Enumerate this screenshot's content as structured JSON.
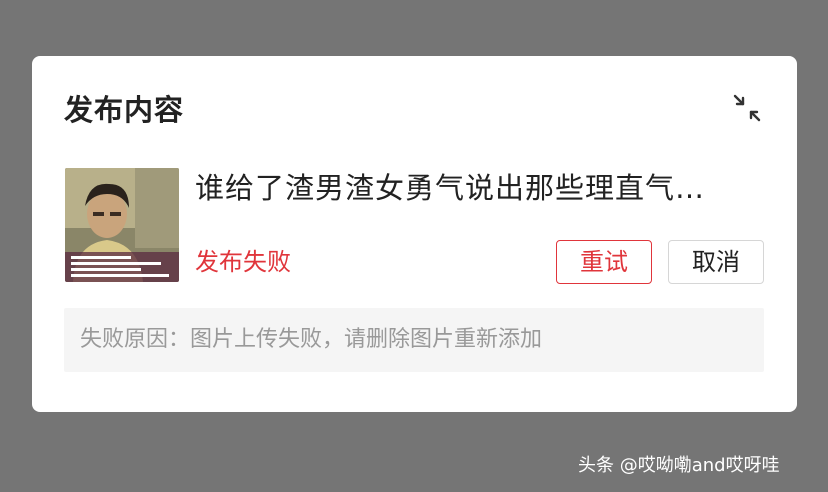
{
  "dialog": {
    "title": "发布内容",
    "collapse_icon": "collapse-arrows-icon"
  },
  "post": {
    "thumbnail_icon": "video-thumbnail",
    "title": "谁给了渣男渣女勇气说出那些理直气…",
    "status": "发布失败"
  },
  "actions": {
    "retry_label": "重试",
    "cancel_label": "取消"
  },
  "reason": {
    "text": "失败原因：图片上传失败，请删除图片重新添加"
  },
  "watermark": {
    "text": "头条 @哎呦嘞and哎呀哇"
  },
  "colors": {
    "overlay": "#757575",
    "accent_red": "#e0353b",
    "reason_bg": "#f5f5f5",
    "reason_text": "#999999",
    "title_text": "#222222"
  }
}
